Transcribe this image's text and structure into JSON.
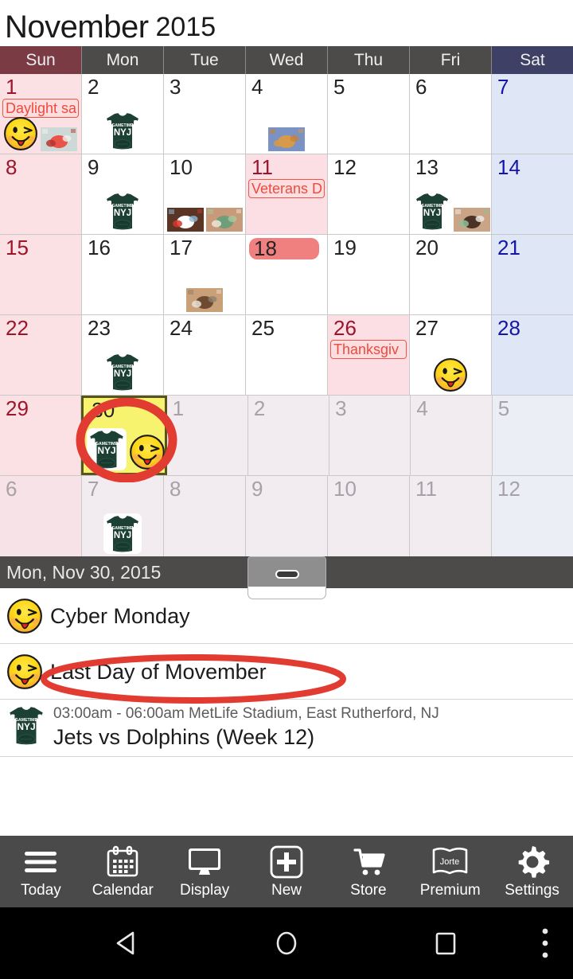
{
  "header": {
    "month_name": "November",
    "year": "2015"
  },
  "weekdays": [
    {
      "label": "Sun",
      "kind": "sun"
    },
    {
      "label": "Mon",
      "kind": "wd"
    },
    {
      "label": "Tue",
      "kind": "wd"
    },
    {
      "label": "Wed",
      "kind": "wd"
    },
    {
      "label": "Thu",
      "kind": "wd"
    },
    {
      "label": "Fri",
      "kind": "wd"
    },
    {
      "label": "Sat",
      "kind": "sat"
    }
  ],
  "colors": {
    "sunday_header": "#7b3b44",
    "saturday_header": "#3f4066",
    "weekday_header": "#4d4a4a",
    "sunday_cell": "#fbe0e4",
    "saturday_cell": "#dfe7f7",
    "holiday_cell": "#fbdfe4",
    "selected_cell": "#f7f36f",
    "selected_border": "#57541e",
    "other_month_cell": "#f2ecf1",
    "event_chip_text": "#ef4a3c",
    "day18_pill": "#f08080",
    "toolbar_bg": "#4a4a4a",
    "date_bar_bg": "#4d4a4a",
    "ink_annotation": "#e23b32"
  },
  "weeks": [
    {
      "days": [
        {
          "num": "1",
          "label": "Daylight sa",
          "icons": [
            "smiley",
            "photo-fruit"
          ]
        },
        {
          "num": "2",
          "icons": [
            "jersey"
          ]
        },
        {
          "num": "3",
          "icons": []
        },
        {
          "num": "4",
          "icons": [
            "photo-food"
          ]
        },
        {
          "num": "5",
          "icons": []
        },
        {
          "num": "6",
          "icons": []
        },
        {
          "num": "7",
          "icons": []
        }
      ]
    },
    {
      "days": [
        {
          "num": "8",
          "icons": []
        },
        {
          "num": "9",
          "icons": [
            "jersey"
          ]
        },
        {
          "num": "10",
          "icons": [
            "photo-choc",
            "photo-cookie"
          ]
        },
        {
          "num": "11",
          "label": "Veterans D",
          "icons": []
        },
        {
          "num": "12",
          "icons": []
        },
        {
          "num": "13",
          "icons": [
            "jersey",
            "photo-board"
          ]
        },
        {
          "num": "14",
          "icons": []
        }
      ]
    },
    {
      "days": [
        {
          "num": "15",
          "icons": []
        },
        {
          "num": "16",
          "icons": []
        },
        {
          "num": "17",
          "icons": [
            "photo-table"
          ]
        },
        {
          "num": "18",
          "icons": []
        },
        {
          "num": "19",
          "icons": []
        },
        {
          "num": "20",
          "icons": []
        },
        {
          "num": "21",
          "icons": []
        }
      ]
    },
    {
      "days": [
        {
          "num": "22",
          "icons": []
        },
        {
          "num": "23",
          "icons": [
            "jersey"
          ]
        },
        {
          "num": "24",
          "icons": []
        },
        {
          "num": "25",
          "icons": []
        },
        {
          "num": "26",
          "label": "Thanksgiv",
          "icons": []
        },
        {
          "num": "27",
          "icons": [
            "smiley"
          ]
        },
        {
          "num": "28",
          "icons": []
        }
      ]
    },
    {
      "days": [
        {
          "num": "29",
          "icons": []
        },
        {
          "num": "30",
          "icons": [
            "jersey",
            "smiley"
          ]
        },
        {
          "num": "1",
          "icons": []
        },
        {
          "num": "2",
          "icons": []
        },
        {
          "num": "3",
          "icons": []
        },
        {
          "num": "4",
          "icons": []
        },
        {
          "num": "5",
          "icons": []
        }
      ]
    },
    {
      "days": [
        {
          "num": "6",
          "icons": []
        },
        {
          "num": "7",
          "icons": [
            "jersey"
          ]
        },
        {
          "num": "8",
          "icons": []
        },
        {
          "num": "9",
          "icons": []
        },
        {
          "num": "10",
          "icons": []
        },
        {
          "num": "11",
          "icons": []
        },
        {
          "num": "12",
          "icons": []
        }
      ]
    }
  ],
  "selected_day": {
    "date_bar_text": "Mon, Nov 30, 2015"
  },
  "events": [
    {
      "icon": "smiley",
      "title": "Cyber Monday",
      "meta": ""
    },
    {
      "icon": "smiley",
      "title": "Last Day of Movember",
      "meta": ""
    },
    {
      "icon": "jersey",
      "title": "Jets vs Dolphins (Week 12)",
      "meta": "03:00am - 06:00am MetLife Stadium, East Rutherford, NJ"
    }
  ],
  "toolbar": [
    {
      "label": "Today",
      "icon": "hamburger-icon"
    },
    {
      "label": "Calendar",
      "icon": "calendar-icon"
    },
    {
      "label": "Display",
      "icon": "monitor-icon"
    },
    {
      "label": "New",
      "icon": "plus-square-icon"
    },
    {
      "label": "Store",
      "icon": "cart-icon"
    },
    {
      "label": "Premium",
      "icon": "jorte-book-icon",
      "brand": "Jorte"
    },
    {
      "label": "Settings",
      "icon": "gear-icon"
    }
  ],
  "navbar": [
    {
      "name": "back-button",
      "icon": "triangle-back-icon"
    },
    {
      "name": "home-button",
      "icon": "circle-home-icon"
    },
    {
      "name": "recents-button",
      "icon": "square-recents-icon"
    },
    {
      "name": "overflow-button",
      "icon": "kebab-menu-icon"
    }
  ]
}
